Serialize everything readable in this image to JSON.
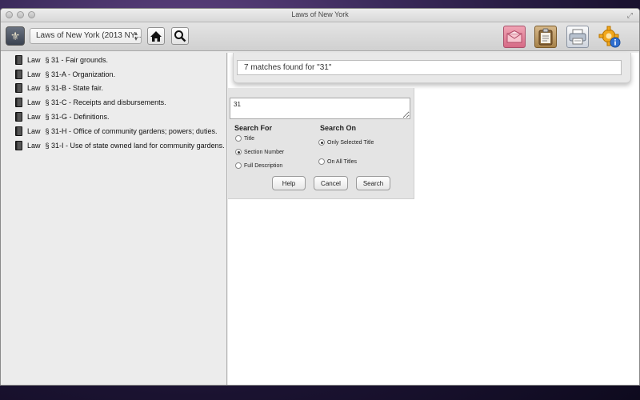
{
  "window": {
    "title": "Laws of New York"
  },
  "toolbar": {
    "title_select": "Laws of New York (2013 NY...",
    "icons": {
      "app": "state-seal-icon",
      "home": "home-icon",
      "search": "magnifier-icon",
      "mail": "envelope-icon",
      "clipboard": "clipboard-icon",
      "print": "printer-icon",
      "settings": "gear-icon"
    }
  },
  "sidebar": {
    "items": [
      {
        "law": "Law",
        "section": "§ 31 - Fair grounds."
      },
      {
        "law": "Law",
        "section": "§ 31-A - Organization."
      },
      {
        "law": "Law",
        "section": "§ 31-B - State fair."
      },
      {
        "law": "Law",
        "section": "§ 31-C - Receipts and disbursements."
      },
      {
        "law": "Law",
        "section": "§ 31-G - Definitions."
      },
      {
        "law": "Law",
        "section": "§ 31-H - Office of community gardens; powers; duties."
      },
      {
        "law": "Law",
        "section": "§ 31-I - Use of state owned land for community gardens."
      }
    ]
  },
  "results": {
    "summary": "7 matches found for \"31\""
  },
  "search_panel": {
    "query": "31",
    "search_for": {
      "label": "Search For",
      "options": [
        "Title",
        "Section Number",
        "Full Description"
      ],
      "selected": "Section Number"
    },
    "search_on": {
      "label": "Search On",
      "options": [
        "Only Selected Title",
        "On All Titles"
      ],
      "selected": "Only Selected Title"
    },
    "buttons": {
      "help": "Help",
      "cancel": "Cancel",
      "search": "Search"
    }
  }
}
